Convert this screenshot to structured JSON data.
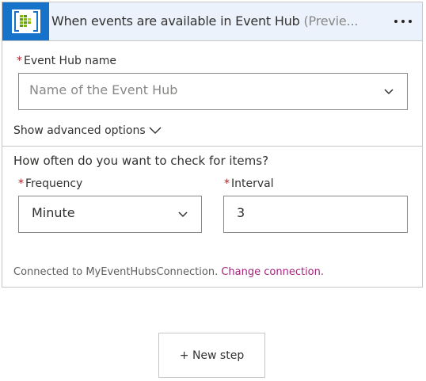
{
  "trigger": {
    "title": "When events are available in Event Hub",
    "preview_tag": "(Previe...",
    "icon": "event-hub-icon",
    "more_icon": "ellipsis-icon"
  },
  "event_hub": {
    "label": "Event Hub name",
    "required_mark": "*",
    "placeholder": "Name of the Event Hub"
  },
  "advanced": {
    "label": "Show advanced options"
  },
  "schedule": {
    "question": "How often do you want to check for items?",
    "frequency_label": "Frequency",
    "frequency_value": "Minute",
    "interval_label": "Interval",
    "interval_value": "3",
    "required_mark": "*"
  },
  "connection": {
    "text": "Connected to MyEventHubsConnection.",
    "change_label": "Change connection."
  },
  "footer": {
    "new_step_label": "+ New step"
  },
  "colors": {
    "header_bg": "#ebf2fb",
    "icon_bg": "#1773c9",
    "link": "#a2267a",
    "required": "#a4262c"
  }
}
